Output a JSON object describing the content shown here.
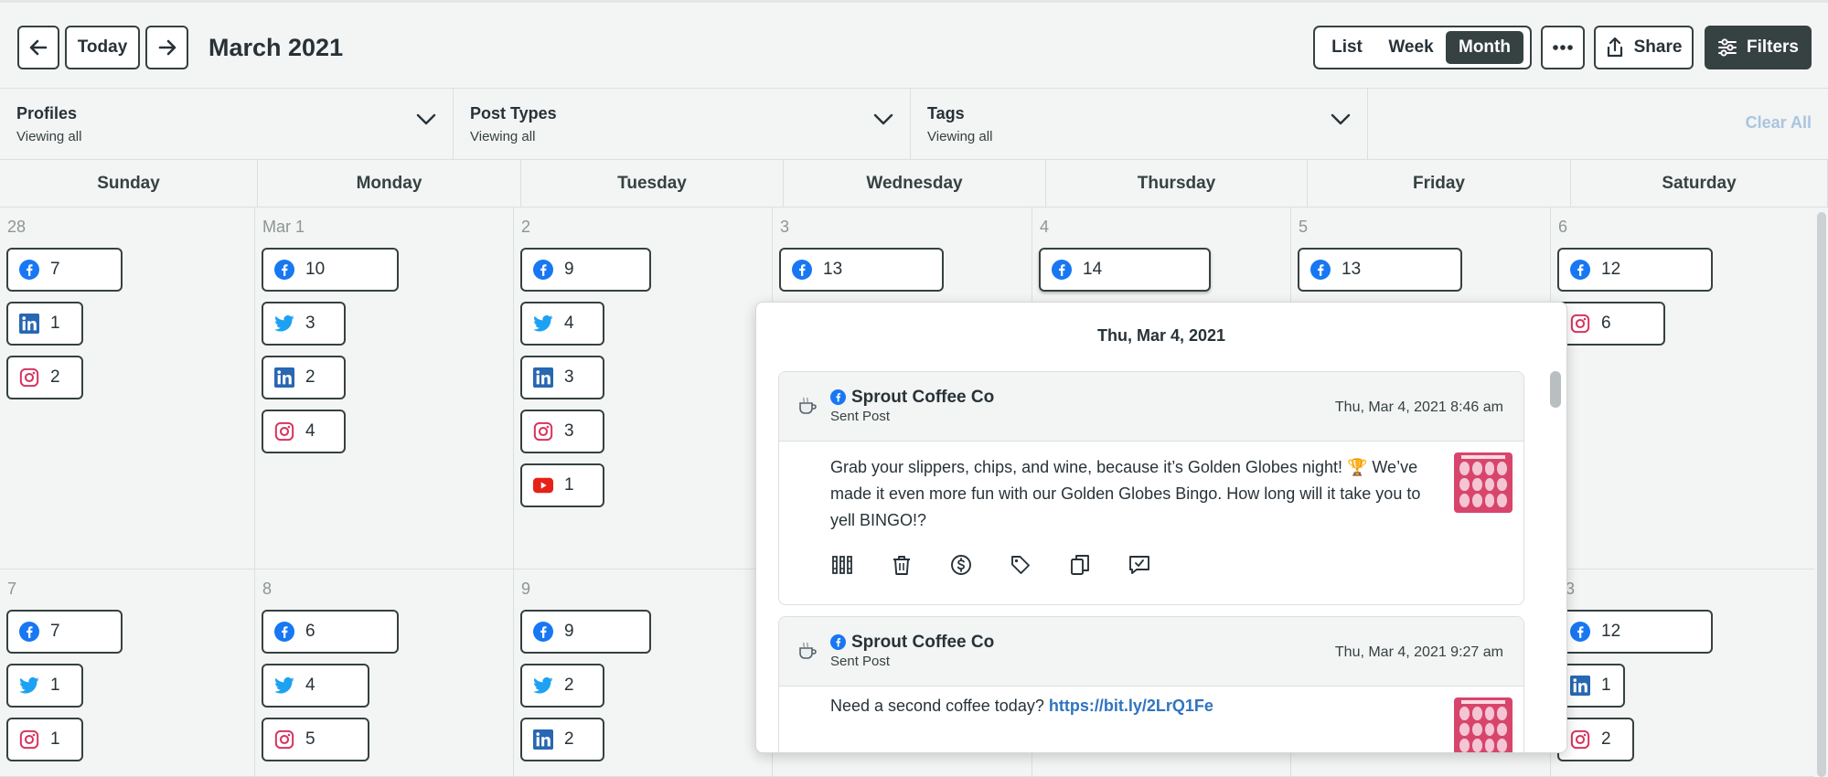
{
  "toolbar": {
    "prev_label": "",
    "today_label": "Today",
    "next_label": "",
    "month_title": "March 2021",
    "views": [
      {
        "label": "List",
        "active": false
      },
      {
        "label": "Week",
        "active": false
      },
      {
        "label": "Month",
        "active": true
      }
    ],
    "more_icon": "ellipsis-icon",
    "share_label": "Share",
    "filters_label": "Filters"
  },
  "filters": [
    {
      "title": "Profiles",
      "subtitle": "Viewing all"
    },
    {
      "title": "Post Types",
      "subtitle": "Viewing all"
    },
    {
      "title": "Tags",
      "subtitle": "Viewing all"
    }
  ],
  "clear_all_label": "Clear All",
  "weekdays": [
    "Sunday",
    "Monday",
    "Tuesday",
    "Wednesday",
    "Thursday",
    "Friday",
    "Saturday"
  ],
  "weeks": [
    [
      {
        "day": "28",
        "pills": [
          {
            "network": "facebook",
            "count": "7"
          },
          {
            "network": "linkedin",
            "count": "1"
          },
          {
            "network": "instagram",
            "count": "2"
          }
        ]
      },
      {
        "day": "Mar 1",
        "pills": [
          {
            "network": "facebook",
            "count": "10"
          },
          {
            "network": "twitter",
            "count": "3"
          },
          {
            "network": "linkedin",
            "count": "2"
          },
          {
            "network": "instagram",
            "count": "4"
          }
        ]
      },
      {
        "day": "2",
        "pills": [
          {
            "network": "facebook",
            "count": "9"
          },
          {
            "network": "twitter",
            "count": "4"
          },
          {
            "network": "linkedin",
            "count": "3"
          },
          {
            "network": "instagram",
            "count": "3"
          },
          {
            "network": "youtube",
            "count": "1"
          }
        ]
      },
      {
        "day": "3",
        "pills": [
          {
            "network": "facebook",
            "count": "13"
          }
        ]
      },
      {
        "day": "4",
        "pills": [
          {
            "network": "facebook",
            "count": "14",
            "focused": true
          }
        ]
      },
      {
        "day": "5",
        "pills": [
          {
            "network": "facebook",
            "count": "13"
          }
        ]
      },
      {
        "day": "6",
        "pills": [
          {
            "network": "facebook",
            "count": "12"
          },
          {
            "network": "instagram",
            "count": "6"
          }
        ]
      }
    ],
    [
      {
        "day": "7",
        "pills": [
          {
            "network": "facebook",
            "count": "7"
          },
          {
            "network": "twitter",
            "count": "1"
          },
          {
            "network": "instagram",
            "count": "1"
          }
        ]
      },
      {
        "day": "8",
        "pills": [
          {
            "network": "facebook",
            "count": "6"
          },
          {
            "network": "twitter",
            "count": "4"
          },
          {
            "network": "instagram",
            "count": "5"
          }
        ]
      },
      {
        "day": "9",
        "pills": [
          {
            "network": "facebook",
            "count": "9"
          },
          {
            "network": "twitter",
            "count": "2"
          },
          {
            "network": "linkedin",
            "count": "2"
          }
        ]
      },
      {
        "day": "",
        "pills": []
      },
      {
        "day": "",
        "pills": []
      },
      {
        "day": "",
        "pills": []
      },
      {
        "day": "3",
        "pills": [
          {
            "network": "facebook",
            "count": "12"
          },
          {
            "network": "linkedin",
            "count": "1"
          },
          {
            "network": "instagram",
            "count": "2"
          }
        ]
      }
    ]
  ],
  "popover": {
    "title": "Thu, Mar 4, 2021",
    "posts": [
      {
        "profile": "Sprout Coffee Co",
        "type": "Sent Post",
        "time": "Thu, Mar 4, 2021 8:46 am",
        "text": "Grab your slippers, chips, and wine, because it’s Golden Globes night! 🏆 We’ve made it even more fun with our Golden Globes Bingo. How long will it take you to yell BINGO!?",
        "link": "",
        "actions": [
          "library-icon",
          "trash-icon",
          "dollar-icon",
          "tag-icon",
          "copy-icon",
          "approve-icon"
        ]
      },
      {
        "profile": "Sprout Coffee Co",
        "type": "Sent Post",
        "time": "Thu, Mar 4, 2021 9:27 am",
        "text": "Need a second coffee today? ",
        "link": "https://bit.ly/2LrQ1Fe",
        "actions": []
      }
    ]
  },
  "colors": {
    "facebook": "#1877f2",
    "twitter": "#1da1f2",
    "linkedin": "#2867b2",
    "instagram": "#d8345f",
    "youtube": "#e62117",
    "dark": "#364141",
    "link": "#2f74c0",
    "clear_all": "#a9c5de"
  }
}
